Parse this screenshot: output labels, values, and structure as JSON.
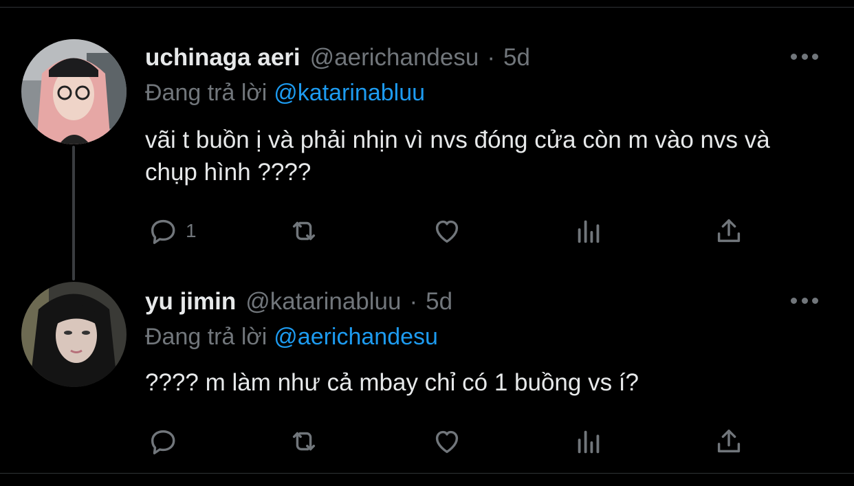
{
  "tweets": [
    {
      "name": "uchinaga aeri",
      "handle": "@aerichandesu",
      "separator": "·",
      "time": "5d",
      "reply_prefix": "Đang trả lời",
      "reply_to": "@katarinabluu",
      "text": "vãi t buồn ị và phải nhịn vì nvs đóng cửa còn m vào nvs và chụp hình ????",
      "reply_count": "1",
      "icons": [
        "reply-icon",
        "retweet-icon",
        "like-icon",
        "views-icon",
        "share-icon",
        "more-icon"
      ]
    },
    {
      "name": "yu jimin",
      "handle": "@katarinabluu",
      "separator": "·",
      "time": "5d",
      "reply_prefix": "Đang trả lời",
      "reply_to": "@aerichandesu",
      "text": "???? m làm như cả mbay chỉ có 1 buồng vs í?",
      "reply_count": "",
      "icons": [
        "reply-icon",
        "retweet-icon",
        "like-icon",
        "views-icon",
        "share-icon",
        "more-icon"
      ]
    }
  ],
  "colors": {
    "background": "#000000",
    "text": "#e7e9ea",
    "muted": "#71767b",
    "link": "#1d9bf0",
    "divider": "#2f3336"
  }
}
